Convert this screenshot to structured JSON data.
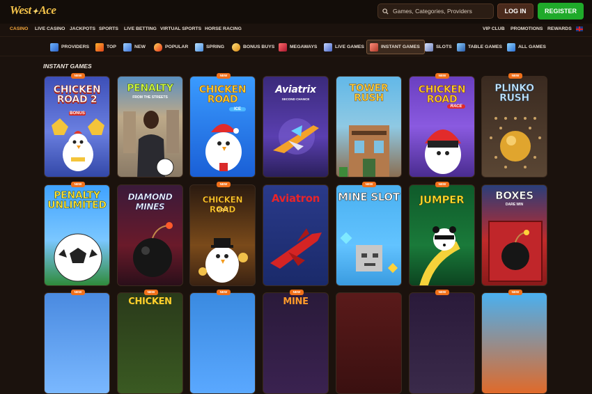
{
  "brand": {
    "logo_left": "West",
    "logo_right": "Ace"
  },
  "search": {
    "placeholder": "Games, Categories, Providers"
  },
  "auth": {
    "login": "LOG IN",
    "register": "REGISTER"
  },
  "main_nav": [
    "CASINO",
    "LIVE CASINO",
    "JACKPOTS",
    "SPORTS",
    "LIVE BETTING",
    "VIRTUAL SPORTS",
    "HORSE RACING"
  ],
  "main_nav_active": "CASINO",
  "right_nav": [
    "VIP CLUB",
    "PROMOTIONS",
    "REWARDS"
  ],
  "categories": [
    "PROVIDERS",
    "TOP",
    "NEW",
    "POPULAR",
    "SPRING",
    "BONUS BUYS",
    "MEGAWAYS",
    "LIVE GAMES",
    "INSTANT GAMES",
    "SLOTS",
    "TABLE GAMES",
    "ALL GAMES"
  ],
  "category_active": "INSTANT GAMES",
  "section": {
    "title": "INSTANT GAMES"
  },
  "badge_label": "NEW",
  "games": [
    {
      "title": "CHICKEN ROAD 2",
      "sub": "BONUS"
    },
    {
      "title": "PENALTY",
      "sub": "FROM THE STREETS"
    },
    {
      "title": "CHICKEN ROAD",
      "sub": "ICE"
    },
    {
      "title": "Aviatrix",
      "sub": "SECOND CHANCE"
    },
    {
      "title": "TOWER RUSH",
      "sub": ""
    },
    {
      "title": "CHICKEN ROAD",
      "sub": "RACE"
    },
    {
      "title": "PLINKO RUSH",
      "sub": ""
    },
    {
      "title": "PENALTY UNLIMITED",
      "sub": ""
    },
    {
      "title": "DIAMOND MINES",
      "sub": ""
    },
    {
      "title": "CHICKEN ROAD",
      "sub": "Gold"
    },
    {
      "title": "Aviatron",
      "sub": ""
    },
    {
      "title": "MINE SLOT",
      "sub": ""
    },
    {
      "title": "JUMPER",
      "sub": ""
    },
    {
      "title": "BOXES",
      "sub": "DARE WIN"
    },
    {
      "title": "",
      "sub": ""
    },
    {
      "title": "CHICKEN",
      "sub": ""
    },
    {
      "title": "",
      "sub": ""
    },
    {
      "title": "MINE",
      "sub": ""
    },
    {
      "title": "",
      "sub": ""
    },
    {
      "title": "",
      "sub": ""
    },
    {
      "title": "",
      "sub": ""
    }
  ],
  "colors": {
    "accent": "#f2a53b",
    "register": "#1faa2a",
    "badge": "#f0701a",
    "background": "#1b120d"
  }
}
